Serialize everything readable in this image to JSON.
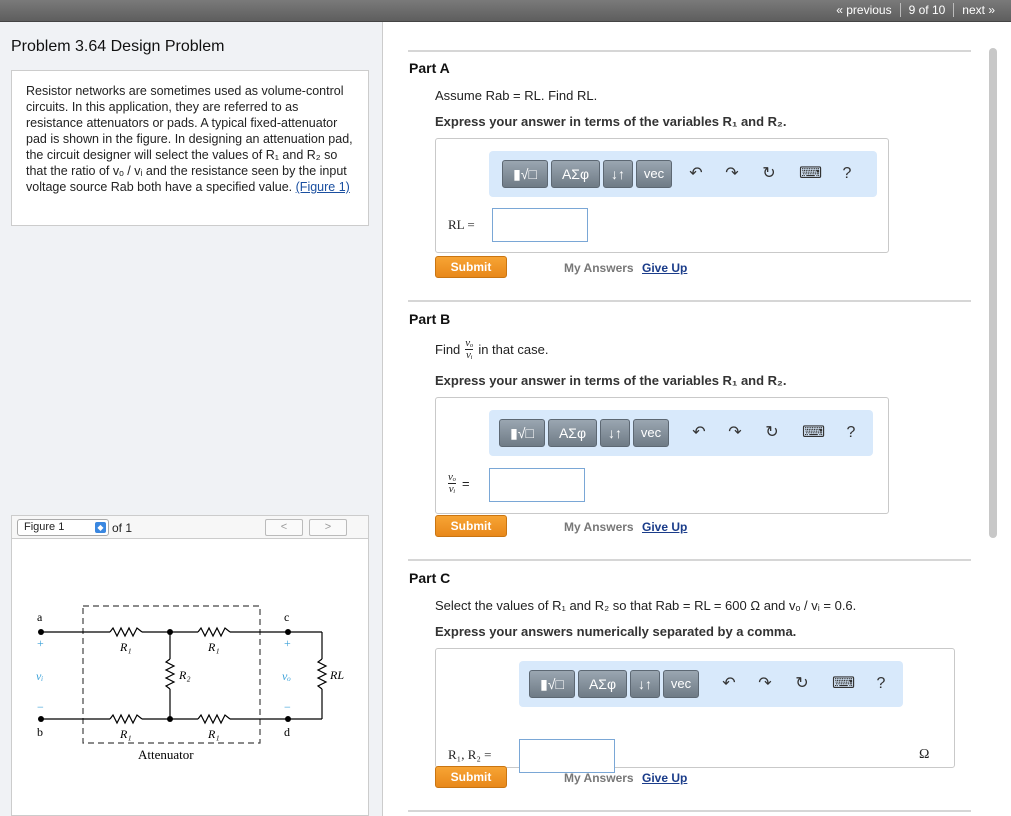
{
  "nav": {
    "previous": "« previous",
    "position": "9 of 10",
    "next": "next »"
  },
  "problem": {
    "title": "Problem 3.64 Design Problem",
    "text": "Resistor networks are sometimes used as volume-control circuits. In this application, they are referred to as resistance attenuators or pads. A typical fixed-attenuator pad is shown in the figure. In designing an attenuation pad, the circuit designer will select the values of R₁ and R₂ so that the ratio of vₒ / vᵢ and the resistance seen by the input voltage source Rab both have a specified value.",
    "figure_link": "(Figure 1)"
  },
  "figure": {
    "selector": "Figure 1",
    "of": "of 1",
    "prev": "<",
    "next": ">",
    "labels": {
      "a": "a",
      "b": "b",
      "c": "c",
      "d": "d",
      "plus_in": "+",
      "minus_in": "−",
      "plus_out": "+",
      "minus_out": "−",
      "vi": "vᵢ",
      "vo": "vₒ",
      "r1a": "R₁",
      "r1b": "R₁",
      "r1c": "R₁",
      "r1d": "R₁",
      "r2": "R₂",
      "rl": "RL",
      "caption": "Attenuator"
    }
  },
  "toolbar": {
    "templates": "▮√□",
    "greek": "ΑΣφ",
    "arrows": "↓↑",
    "vec": "vec",
    "undo": "↶",
    "redo": "↷",
    "reset": "↻",
    "keyboard": "⌨",
    "help": "?"
  },
  "partA": {
    "label": "Part A",
    "question": "Assume Rab = RL. Find RL.",
    "instruction": "Express your answer in terms of the variables R₁ and R₂.",
    "answer_label": "RL =",
    "submit": "Submit",
    "my_answers": "My Answers",
    "give_up": "Give Up"
  },
  "partB": {
    "label": "Part B",
    "question_pre": "Find",
    "question_frac_num": "vₒ",
    "question_frac_den": "vᵢ",
    "question_post": "in that case.",
    "instruction": "Express your answer in terms of the variables R₁ and R₂.",
    "answer_num": "vₒ",
    "answer_den": "vᵢ",
    "answer_eq": "=",
    "submit": "Submit",
    "my_answers": "My Answers",
    "give_up": "Give Up"
  },
  "partC": {
    "label": "Part C",
    "question": "Select the values of R₁ and R₂ so that Rab = RL = 600 Ω and vₒ / vᵢ = 0.6.",
    "instruction": "Express your answers numerically separated by a comma.",
    "answer_label": "R₁, R₂ =",
    "unit": "Ω",
    "submit": "Submit",
    "my_answers": "My Answers",
    "give_up": "Give Up"
  }
}
